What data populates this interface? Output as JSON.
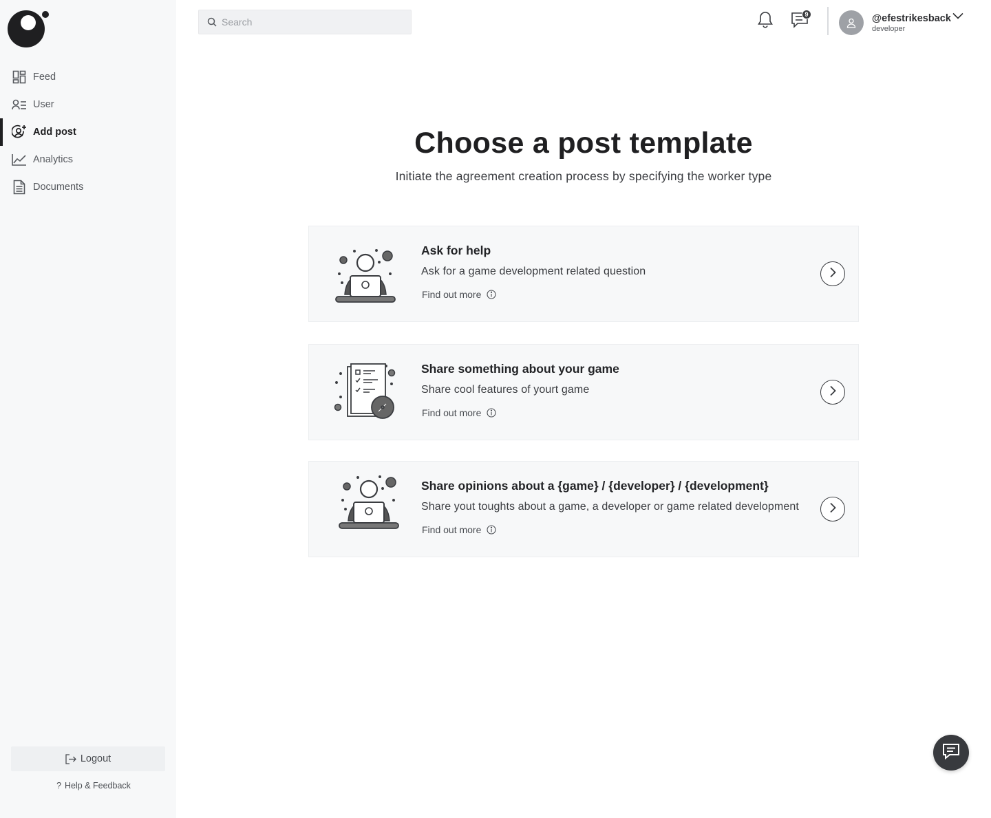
{
  "sidebar": {
    "logo": "logo-mark",
    "items": [
      {
        "label": "Feed",
        "icon": "grid-icon"
      },
      {
        "label": "User",
        "icon": "user-list-icon"
      },
      {
        "label": "Add post",
        "icon": "user-add-icon",
        "active": true
      },
      {
        "label": "Analytics",
        "icon": "chart-line-icon"
      },
      {
        "label": "Documents",
        "icon": "document-icon"
      }
    ],
    "logout_label": "Logout",
    "help_label": "Help & Feedback"
  },
  "header": {
    "search_placeholder": "Search",
    "message_count": "9",
    "username": "@efestrikesback",
    "role": "developer"
  },
  "main": {
    "title": "Choose a post template",
    "subtitle": "Initiate the agreement creation process by specifying the worker type",
    "cards": [
      {
        "title": "Ask for help",
        "description": "Ask for a game development related question",
        "more_label": "Find out more"
      },
      {
        "title": "Share something about your game",
        "description": "Share cool features of yourt game",
        "more_label": "Find out more"
      },
      {
        "title": "Share opinions about a {game} / {developer} / {development}",
        "description": "Share yout toughts about a game, a developer or game related development",
        "more_label": "Find out more"
      }
    ]
  },
  "colors": {
    "sidebar_bg": "#f7f8f9",
    "card_bg": "#f7f8f9",
    "text_dark": "#1f1f21",
    "fab_bg": "#383a3e"
  }
}
